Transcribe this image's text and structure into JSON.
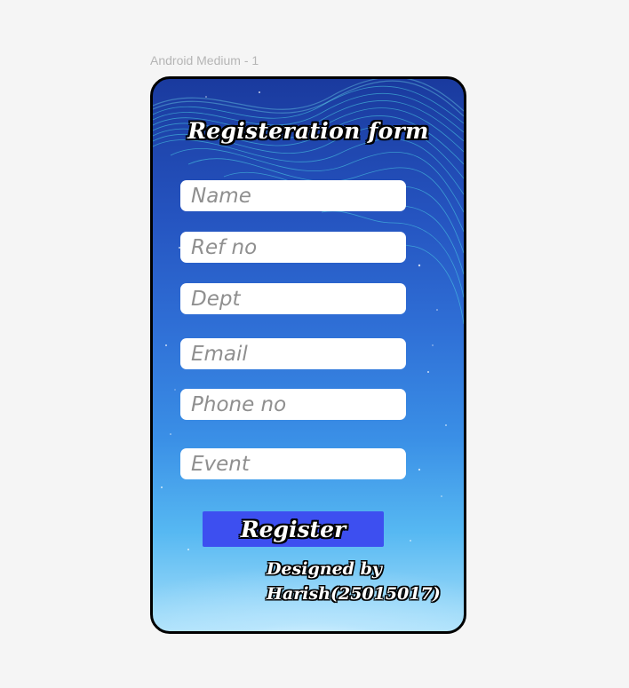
{
  "frame": {
    "label": "Android Medium - 1"
  },
  "form": {
    "title": "Registeration form",
    "fields": [
      {
        "placeholder": "Name",
        "value": ""
      },
      {
        "placeholder": "Ref no",
        "value": ""
      },
      {
        "placeholder": "Dept",
        "value": ""
      },
      {
        "placeholder": "Email",
        "value": ""
      },
      {
        "placeholder": "Phone no",
        "value": ""
      },
      {
        "placeholder": "Event",
        "value": ""
      }
    ],
    "register_label": "Register"
  },
  "credit": {
    "line1": "Designed by",
    "line2": "Harish(25015017)"
  },
  "colors": {
    "page_background": "#f5f5f5",
    "button": "#3d4ff0",
    "field_background": "#ffffff",
    "placeholder": "#8f8f8f"
  }
}
